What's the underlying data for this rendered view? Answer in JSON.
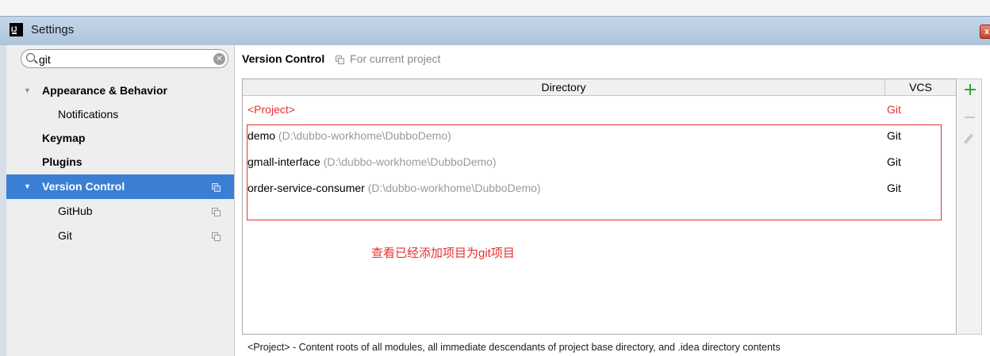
{
  "window": {
    "title": "Settings",
    "close_glyph": "x"
  },
  "search": {
    "value": "git",
    "clear_glyph": "✕"
  },
  "sidebar": {
    "items": [
      {
        "label": "Appearance & Behavior",
        "expanded": true,
        "bold": true
      },
      {
        "label": "Notifications"
      },
      {
        "label": "Keymap",
        "bold": true
      },
      {
        "label": "Plugins",
        "bold": true
      },
      {
        "label": "Version Control",
        "expanded": true,
        "bold": true,
        "selected": true,
        "project_scoped": true
      },
      {
        "label": "GitHub",
        "project_scoped": true
      },
      {
        "label": "Git",
        "project_scoped": true
      }
    ]
  },
  "main": {
    "title": "Version Control",
    "scope": "For current project",
    "table": {
      "columns": {
        "directory": "Directory",
        "vcs": "VCS"
      },
      "rows": [
        {
          "name": "<Project>",
          "path": "",
          "vcs": "Git"
        },
        {
          "name": "demo",
          "path": "(D:\\dubbo-workhome\\DubboDemo)",
          "vcs": "Git"
        },
        {
          "name": "gmall-interface",
          "path": "(D:\\dubbo-workhome\\DubboDemo)",
          "vcs": "Git"
        },
        {
          "name": "order-service-consumer",
          "path": "(D:\\dubbo-workhome\\DubboDemo)",
          "vcs": "Git"
        }
      ]
    },
    "annotation": "查看已经添加项目为git项目",
    "footer": "<Project> - Content roots of all modules, all immediate descendants of project base directory, and .idea directory contents"
  },
  "colors": {
    "accent": "#3b7fd4",
    "annotation_red": "#e53131",
    "add_green": "#35a335"
  },
  "icons": {
    "app": "intellij-icon",
    "search": "search-icon",
    "clear": "clear-icon",
    "expand": "triangle-down-icon",
    "project_scope": "copy-icon",
    "add": "plus-icon",
    "remove": "minus-icon",
    "edit": "pencil-icon"
  }
}
